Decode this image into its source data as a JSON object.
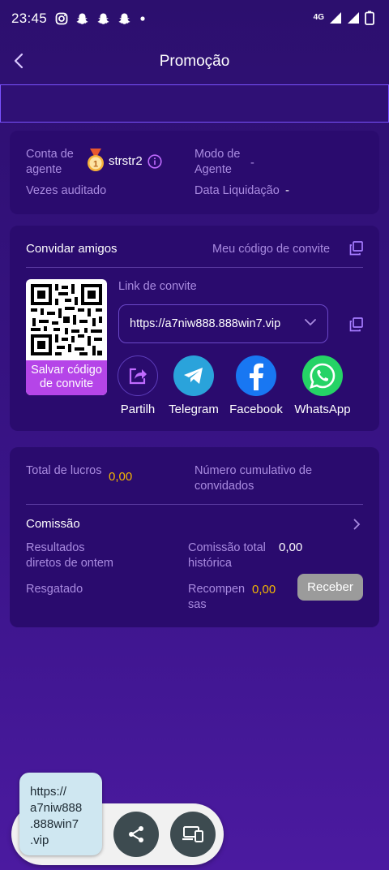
{
  "status_bar": {
    "time": "23:45",
    "network": "4G",
    "app_icons": [
      "instagram-icon",
      "snapchat-icon",
      "snapchat-icon",
      "snapchat-icon",
      "dot-icon"
    ]
  },
  "header": {
    "title": "Promoção"
  },
  "agent_card": {
    "account_label": "Conta de\nagente",
    "agent_name": "strstr2",
    "mode_label": "Modo de\nAgente",
    "mode_value": "-",
    "audited_label": "Vezes auditado",
    "settlement_label": "Data Liquidação",
    "settlement_value": "-"
  },
  "invite_card": {
    "title": "Convidar amigos",
    "my_code_label": "Meu código de convite",
    "link_label": "Link de convite",
    "link_value": "https://a7niw888.888win7.vip",
    "save_qr_label": "Salvar código de convite",
    "share_options": [
      {
        "label": "Partilh",
        "icon": "share-icon",
        "color": "#2a0b6e"
      },
      {
        "label": "Telegram",
        "icon": "telegram-icon",
        "color": "#2aa3db"
      },
      {
        "label": "Facebook",
        "icon": "facebook-icon",
        "color": "#1877f2"
      },
      {
        "label": "WhatsApp",
        "icon": "whatsapp-icon",
        "color": "#25d366"
      }
    ]
  },
  "earnings_card": {
    "total_profit_label": "Total de lucros",
    "total_profit_value": "0,00",
    "cumulative_label": "Número cumulativo de\nconvidados",
    "commission_label": "Comissão",
    "direct_results_label": "Resultados\ndiretos de ontem",
    "total_commission_label": "Comissão total\nhistórica",
    "total_commission_value": "0,00",
    "redeemed_label": "Resgatado",
    "rewards_label": "Recompen\nsas",
    "rewards_value": "0,00",
    "receive_button": "Receber"
  },
  "clipboard_preview": {
    "text": "https://\na7niw888\n.888win7\n.vip"
  },
  "colors": {
    "accent_gold": "#f5b700",
    "muted_text": "#a98be0",
    "card_bg": "#2a0b6e"
  }
}
